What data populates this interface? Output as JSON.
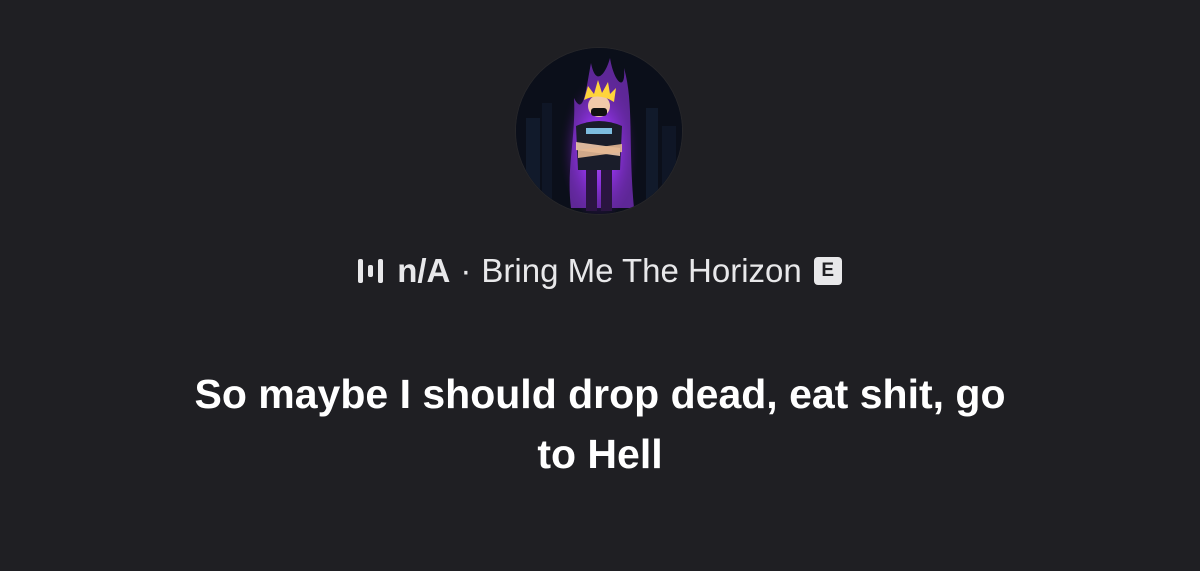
{
  "header": {
    "track": "n/A",
    "separator": "·",
    "artist": "Bring Me The Horizon",
    "explicit_badge": "E"
  },
  "lyric": {
    "line1": "So maybe I should drop dead, eat shit, go",
    "line2": "to Hell"
  },
  "icons": {
    "now_playing": "equalizer-bars-icon",
    "explicit": "explicit-icon"
  },
  "colors": {
    "background": "#1f1f23",
    "text": "#e8e8ea",
    "lyric": "#ffffff",
    "avatar_accent": "#b03cff"
  }
}
